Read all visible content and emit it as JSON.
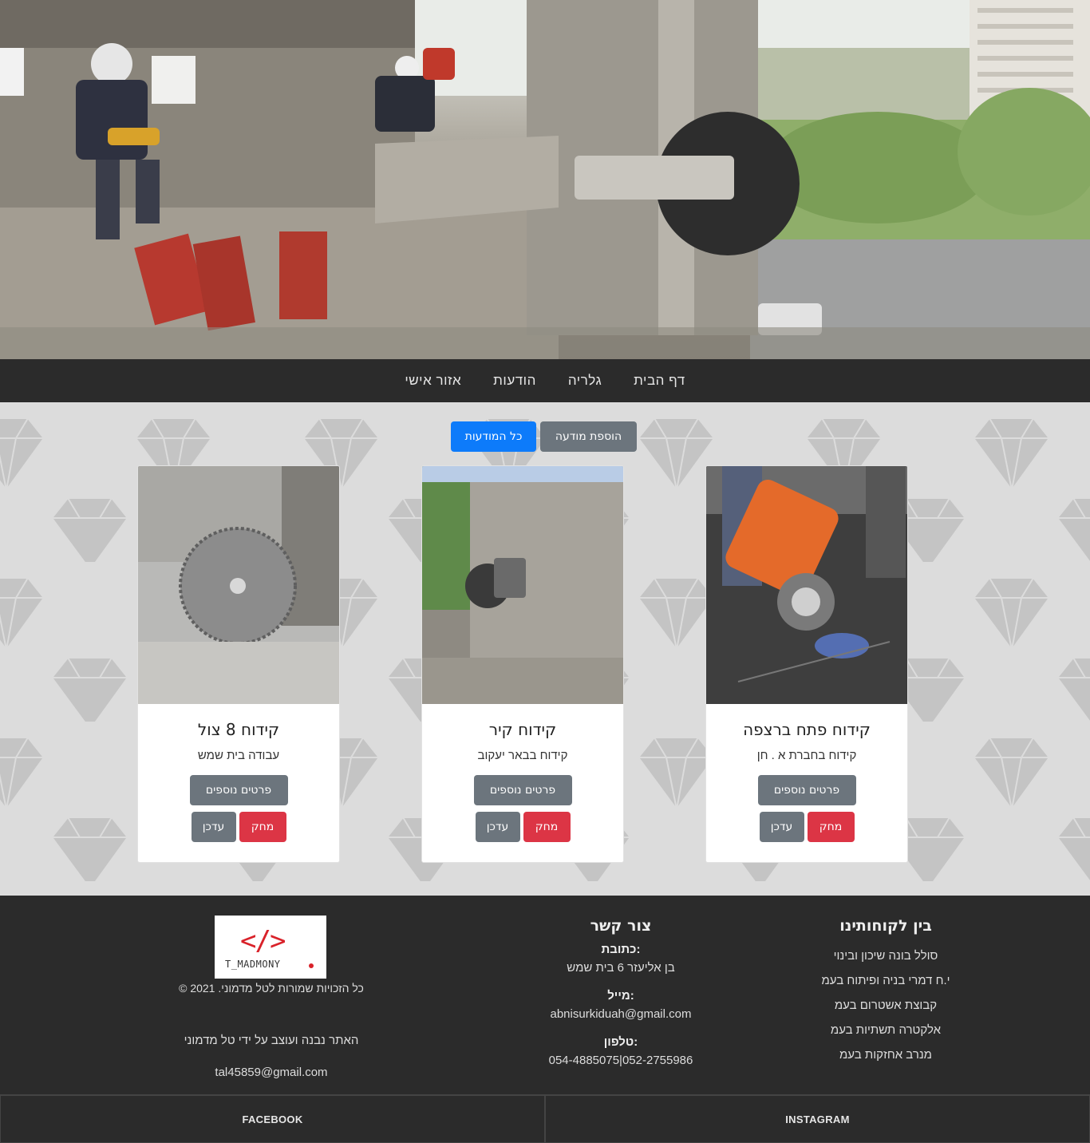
{
  "nav": {
    "items": [
      "דף הבית",
      "גלריה",
      "הודעות",
      "אזור אישי"
    ]
  },
  "toolbar": {
    "add_label": "הוספת מודעה",
    "all_label": "כל המודעות"
  },
  "cards": [
    {
      "title": "קידוח פתח ברצפה",
      "subtitle": "קידוח בחברת א . חן",
      "more_label": "פרטים נוספים",
      "delete_label": "מחק",
      "edit_label": "עדכן"
    },
    {
      "title": "קידוח קיר",
      "subtitle": "קידוח בבאר יעקוב",
      "more_label": "פרטים נוספים",
      "delete_label": "מחק",
      "edit_label": "עדכן"
    },
    {
      "title": "קידוח 8 צול",
      "subtitle": "עבודה בית שמש",
      "more_label": "פרטים נוספים",
      "delete_label": "מחק",
      "edit_label": "עדכן"
    }
  ],
  "footer": {
    "clients": {
      "title": "בין לקוחותינו",
      "items": [
        "סולל בונה שיכון ובינוי",
        "י.ח דמרי בניה ופיתוח בעמ",
        "קבוצת אשטרום בעמ",
        "אלקטרה תשתיות בעמ",
        "מנרב אחזקות בעמ"
      ]
    },
    "contact": {
      "title": "צור קשר",
      "address_label": ":כתובת",
      "address": "בן אליעזר 6 בית שמש",
      "email_label": ":מייל",
      "email": "abnisurkiduah@gmail.com",
      "phone_label": ":טלפון",
      "phone": "052-2755986|054-4885075"
    },
    "credits": {
      "logo_brackets": "</>",
      "logo_text": "T_MADMONY",
      "copyright": "כל הזכויות שמורות לטל מדמוני.  2021  ©",
      "built_by": "האתר נבנה ועוצב על ידי טל מדמוני",
      "email": "tal45859@gmail.com"
    }
  },
  "social": {
    "facebook": "FACEBOOK",
    "instagram": "INSTAGRAM"
  }
}
